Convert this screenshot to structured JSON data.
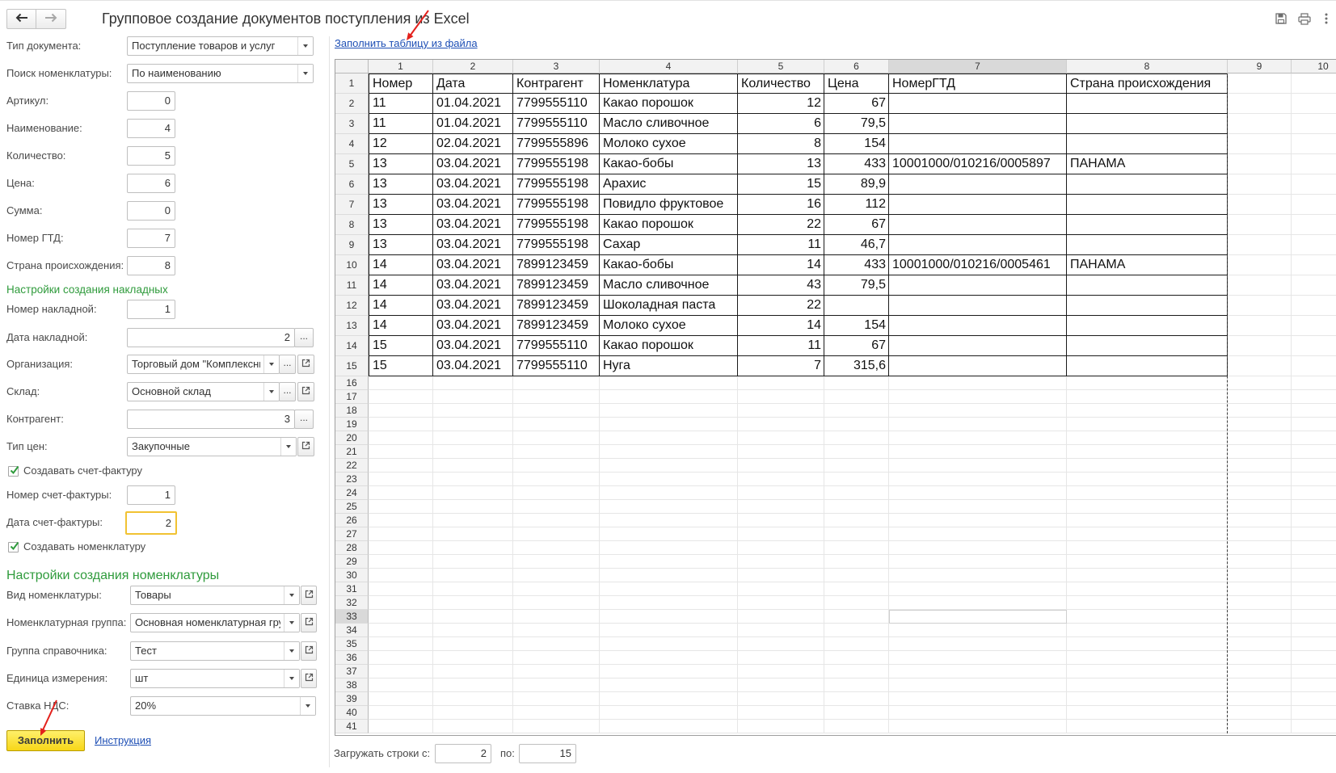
{
  "window": {
    "title": "Групповое создание документов поступления из Excel"
  },
  "icons": {
    "back": "arrow-left-icon",
    "forward": "arrow-right-icon",
    "save": "save-icon",
    "print": "print-icon",
    "more": "more-vertical-icon",
    "dropdown": "chevron-down-icon",
    "open": "open-form-icon",
    "checkbox": "checkmark-icon"
  },
  "colors": {
    "accent_green": "#2f9b3c",
    "link": "#1e4fb5",
    "button_yellow": "#f7d618",
    "annotation_red": "#e3211c",
    "focus_border": "#f1c232"
  },
  "form": {
    "ellipsis": "...",
    "doc_type": {
      "label": "Тип документа:",
      "value": "Поступление товаров и услуг"
    },
    "search": {
      "label": "Поиск номенклатуры:",
      "value": "По наименованию"
    },
    "article": {
      "label": "Артикул:",
      "value": "0"
    },
    "name": {
      "label": "Наименование:",
      "value": "4"
    },
    "quantity": {
      "label": "Количество:",
      "value": "5"
    },
    "price": {
      "label": "Цена:",
      "value": "6"
    },
    "sum": {
      "label": "Сумма:",
      "value": "0"
    },
    "gtd": {
      "label": "Номер ГТД:",
      "value": "7"
    },
    "country": {
      "label": "Страна происхождения:",
      "value": "8"
    },
    "invoice_settings_title": "Настройки создания накладных",
    "invoice_number": {
      "label": "Номер накладной:",
      "value": "1"
    },
    "invoice_date": {
      "label": "Дата накладной:",
      "value": "2"
    },
    "organization": {
      "label": "Организация:",
      "value": "Торговый дом \"Комплексны"
    },
    "warehouse": {
      "label": "Склад:",
      "value": "Основной склад"
    },
    "counterparty": {
      "label": "Контрагент:",
      "value": "3"
    },
    "price_type": {
      "label": "Тип цен:",
      "value": "Закупочные"
    },
    "create_sf": {
      "label": "Создавать счет-фактуру",
      "checked": true
    },
    "sf_number": {
      "label": "Номер счет-фактуры:",
      "value": "1"
    },
    "sf_date": {
      "label": "Дата счет-фактуры:",
      "value": "2"
    },
    "create_items": {
      "label": "Создавать номенклатуру",
      "checked": true
    },
    "items_settings_title": "Настройки создания номенклатуры",
    "item_kind": {
      "label": "Вид номенклатуры:",
      "value": "Товары"
    },
    "item_group": {
      "label": "Номенклатурная группа:",
      "value": "Основная номенклатурная гру"
    },
    "directory_group": {
      "label": "Группа справочника:",
      "value": "Тест"
    },
    "unit": {
      "label": "Единица измерения:",
      "value": "шт"
    },
    "vat_rate": {
      "label": "Ставка НДС:",
      "value": "20%"
    },
    "fill_button": "Заполнить",
    "instruction_link": "Инструкция"
  },
  "fill_from_file_link": "Заполнить таблицу из файла",
  "sheet": {
    "col_headers": [
      "1",
      "2",
      "3",
      "4",
      "5",
      "6",
      "7",
      "8",
      "9",
      "10"
    ],
    "row_headers": [
      "1",
      "2",
      "3",
      "4",
      "5",
      "6",
      "7",
      "8",
      "9",
      "10",
      "11",
      "12",
      "13",
      "14",
      "15",
      "16",
      "17",
      "18",
      "19",
      "20",
      "21",
      "22",
      "23",
      "24",
      "25",
      "26",
      "27",
      "28",
      "29",
      "30",
      "31",
      "32",
      "33",
      "34",
      "35",
      "36",
      "37",
      "38",
      "39",
      "40",
      "41"
    ],
    "selected_cell": {
      "row": 33,
      "column": 7
    },
    "rows": [
      [
        "Номер",
        "Дата",
        "Контрагент",
        "Номенклатура",
        "Количество",
        "Цена",
        "НомерГТД",
        "Страна происхождения"
      ],
      [
        "11",
        "01.04.2021",
        "7799555110",
        "Какао порошок",
        "12",
        "67",
        "",
        ""
      ],
      [
        "11",
        "01.04.2021",
        "7799555110",
        "Масло сливочное",
        "6",
        "79,5",
        "",
        ""
      ],
      [
        "12",
        "02.04.2021",
        "7799555896",
        "Молоко сухое",
        "8",
        "154",
        "",
        ""
      ],
      [
        "13",
        "03.04.2021",
        "7799555198",
        "Какао-бобы",
        "13",
        "433",
        "10001000/010216/0005897",
        "ПАНАМА"
      ],
      [
        "13",
        "03.04.2021",
        "7799555198",
        "Арахис",
        "15",
        "89,9",
        "",
        ""
      ],
      [
        "13",
        "03.04.2021",
        "7799555198",
        "Повидло фруктовое",
        "16",
        "112",
        "",
        ""
      ],
      [
        "13",
        "03.04.2021",
        "7799555198",
        "Какао порошок",
        "22",
        "67",
        "",
        ""
      ],
      [
        "13",
        "03.04.2021",
        "7799555198",
        "Сахар",
        "11",
        "46,7",
        "",
        ""
      ],
      [
        "14",
        "03.04.2021",
        "7899123459",
        "Какао-бобы",
        "14",
        "433",
        "10001000/010216/0005461",
        "ПАНАМА"
      ],
      [
        "14",
        "03.04.2021",
        "7899123459",
        "Масло сливочное",
        "43",
        "79,5",
        "",
        ""
      ],
      [
        "14",
        "03.04.2021",
        "7899123459",
        "Шоколадная паста",
        "22",
        "",
        "",
        ""
      ],
      [
        "14",
        "03.04.2021",
        "7899123459",
        "Молоко сухое",
        "14",
        "154",
        "",
        ""
      ],
      [
        "15",
        "03.04.2021",
        "7799555110",
        "Какао порошок",
        "11",
        "67",
        "",
        ""
      ],
      [
        "15",
        "03.04.2021",
        "7799555110",
        "Нуга",
        "7",
        "315,6",
        "",
        ""
      ]
    ]
  },
  "load_rows": {
    "from_label": "Загружать строки с:",
    "from_value": "2",
    "to_label": "по:",
    "to_value": "15"
  }
}
